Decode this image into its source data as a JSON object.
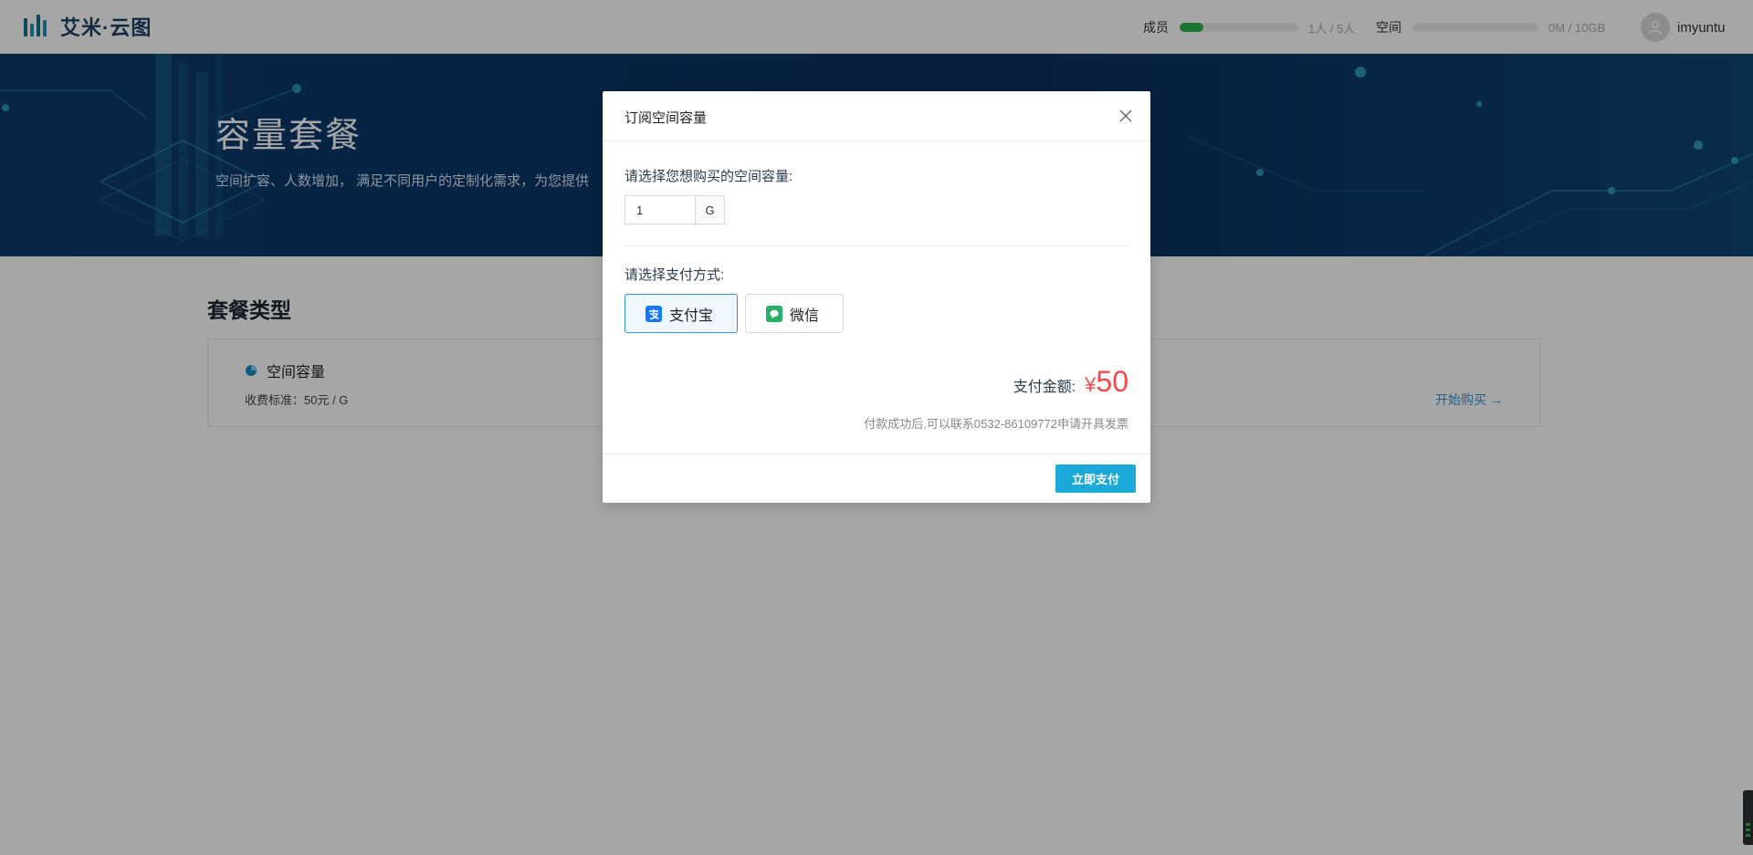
{
  "header": {
    "logo_text": "艾米·云图",
    "members": {
      "label": "成员",
      "value": "1人 / 5人",
      "progress": 0.2
    },
    "space": {
      "label": "空间",
      "value": "0M / 10GB",
      "progress": 0.0
    },
    "username": "imyuntu"
  },
  "banner": {
    "title": "容量套餐",
    "subtitle": "空间扩容、人数增加，  满足不同用户的定制化需求，为您提供"
  },
  "content": {
    "section_title": "套餐类型",
    "plan": {
      "name": "空间容量",
      "price": "收费标准：50元 / G",
      "buy_label": "开始购买",
      "buy_arrow": "→"
    }
  },
  "modal": {
    "title": "订阅空间容量",
    "capacity_prompt": "请选择您想购买的空间容量:",
    "capacity_value": "1",
    "capacity_unit": "G",
    "payment_prompt": "请选择支付方式:",
    "payment_methods": [
      {
        "label": "支付宝",
        "icon": "alipay-icon",
        "selected": true,
        "color": "#1677ff"
      },
      {
        "label": "微信",
        "icon": "wechat-icon",
        "selected": false,
        "color": "#2aae67"
      }
    ],
    "amount_label": "支付金额:",
    "amount_currency": "¥",
    "amount_value": "50",
    "invoice_note": "付款成功后,可以联系0532-86109772申请开具发票",
    "pay_button": "立即支付"
  },
  "colors": {
    "accent": "#1ba9d8",
    "price": "#f04a4a",
    "banner": "#0b3668",
    "progress": "#2bb24c"
  }
}
